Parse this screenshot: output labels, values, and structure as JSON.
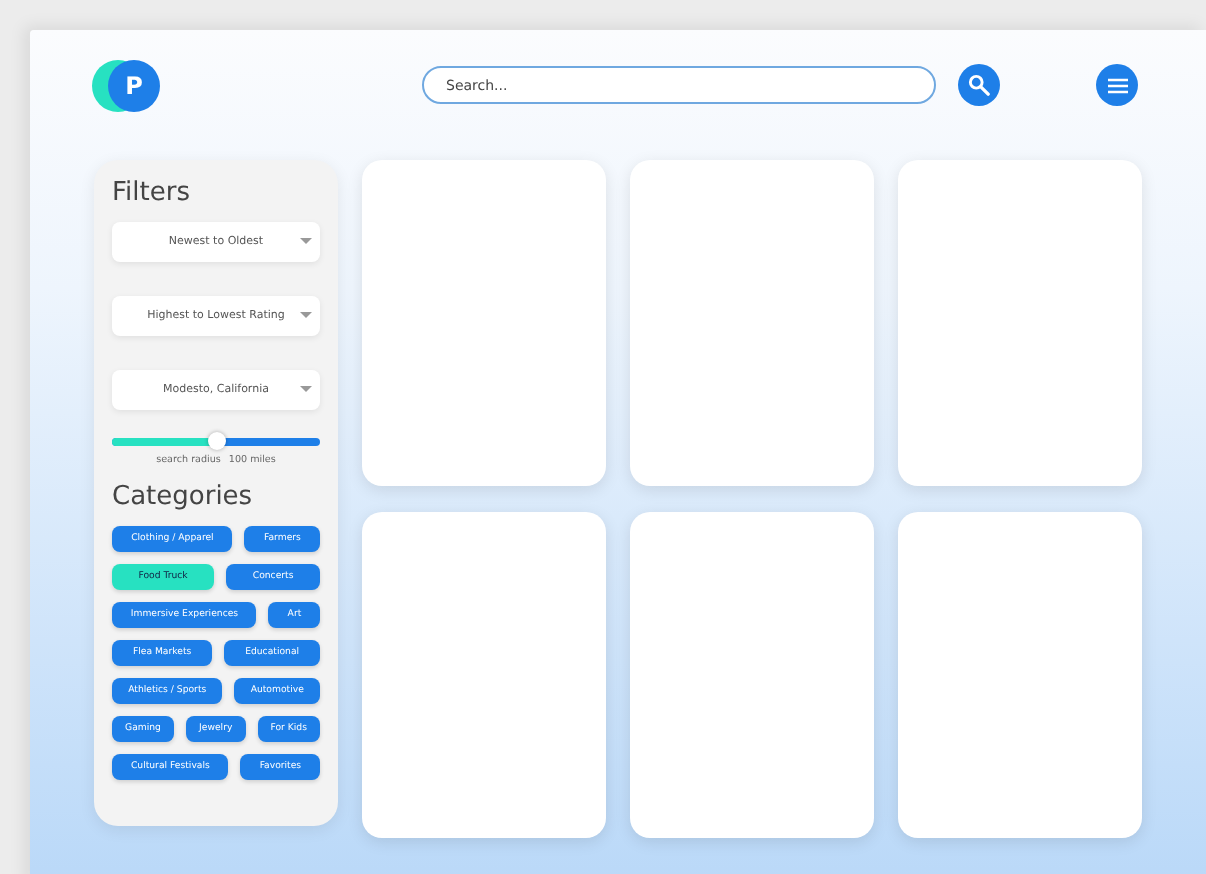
{
  "header": {
    "logo": "P",
    "search": {
      "placeholder": "Search..."
    }
  },
  "filters": {
    "title": "Filters",
    "dropdowns": [
      {
        "value": "Newest to Oldest"
      },
      {
        "value": "Highest to Lowest Rating"
      },
      {
        "value": "Modesto, California"
      }
    ],
    "radius": {
      "level": 0.5,
      "label": "search radius",
      "reading": "100 miles"
    }
  },
  "categories": {
    "title": "Categories",
    "rows": [
      {
        "chips": [
          {
            "label": "Clothing / Apparel",
            "selected": false
          },
          {
            "label": "Farmers",
            "selected": false
          }
        ]
      },
      {
        "chips": [
          {
            "label": "Food Truck",
            "selected": true
          },
          {
            "label": "Concerts",
            "selected": false
          }
        ]
      },
      {
        "chips": [
          {
            "label": "Immersive Experiences",
            "selected": false
          },
          {
            "label": "Art",
            "selected": false
          }
        ]
      },
      {
        "chips": [
          {
            "label": "Flea Markets",
            "selected": false
          },
          {
            "label": "Educational",
            "selected": false
          }
        ]
      },
      {
        "chips": [
          {
            "label": "Athletics / Sports",
            "selected": false
          },
          {
            "label": "Automotive",
            "selected": false
          }
        ]
      },
      {
        "chips": [
          {
            "label": "Gaming",
            "selected": false
          },
          {
            "label": "Jewelry",
            "selected": false
          },
          {
            "label": "For Kids",
            "selected": false
          }
        ]
      },
      {
        "chips": [
          {
            "label": "Cultural Festivals",
            "selected": false
          },
          {
            "label": "Favorites",
            "selected": false
          }
        ]
      }
    ]
  },
  "cards": [
    {
      "kind": "empty"
    },
    {
      "kind": "empty"
    },
    {
      "kind": "empty"
    },
    {
      "kind": "empty"
    },
    {
      "kind": "empty"
    },
    {
      "kind": "empty"
    }
  ]
}
